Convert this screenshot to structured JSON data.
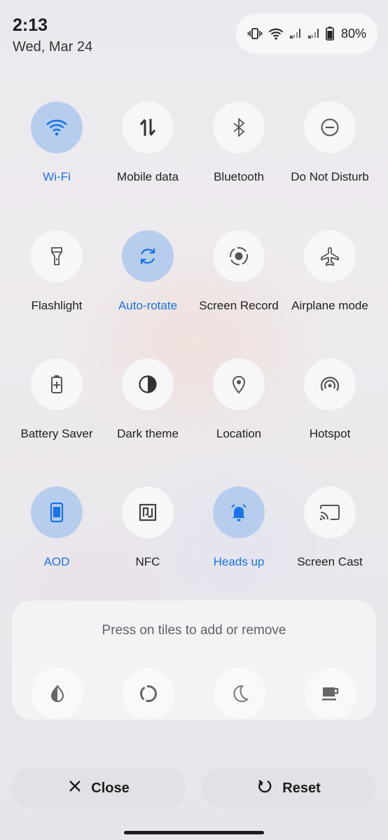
{
  "status": {
    "time": "2:13",
    "date": "Wed, Mar 24",
    "battery_pct": "80%",
    "icons": [
      "vibrate-icon",
      "wifi-icon",
      "signal-icon",
      "signal-icon",
      "battery-icon"
    ]
  },
  "tiles": [
    {
      "label": "Wi-Fi",
      "active": true,
      "icon": "wifi-icon"
    },
    {
      "label": "Mobile data",
      "active": false,
      "icon": "mobile-data-icon"
    },
    {
      "label": "Bluetooth",
      "active": false,
      "icon": "bluetooth-icon"
    },
    {
      "label": "Do Not Disturb",
      "active": false,
      "icon": "do-not-disturb-icon"
    },
    {
      "label": "Flashlight",
      "active": false,
      "icon": "flashlight-icon"
    },
    {
      "label": "Auto-rotate",
      "active": true,
      "icon": "auto-rotate-icon"
    },
    {
      "label": "Screen Record",
      "active": false,
      "icon": "screen-record-icon"
    },
    {
      "label": "Airplane mode",
      "active": false,
      "icon": "airplane-icon"
    },
    {
      "label": "Battery Saver",
      "active": false,
      "icon": "battery-saver-icon"
    },
    {
      "label": "Dark theme",
      "active": false,
      "icon": "dark-theme-icon"
    },
    {
      "label": "Location",
      "active": false,
      "icon": "location-icon"
    },
    {
      "label": "Hotspot",
      "active": false,
      "icon": "hotspot-icon"
    },
    {
      "label": "AOD",
      "active": true,
      "icon": "aod-icon"
    },
    {
      "label": "NFC",
      "active": false,
      "icon": "nfc-icon"
    },
    {
      "label": "Heads up",
      "active": true,
      "icon": "heads-up-icon"
    },
    {
      "label": "Screen Cast",
      "active": false,
      "icon": "screen-cast-icon"
    }
  ],
  "tray": {
    "hint": "Press on tiles to add or remove",
    "icons": [
      "color-inversion-icon",
      "data-saver-icon",
      "night-light-icon",
      "caffeine-icon"
    ]
  },
  "actions": {
    "close_label": "Close",
    "reset_label": "Reset"
  },
  "colors": {
    "active_tile": "#b7cdee",
    "active_text": "#1a73e8",
    "inactive_tile": "#f7f6f8"
  }
}
